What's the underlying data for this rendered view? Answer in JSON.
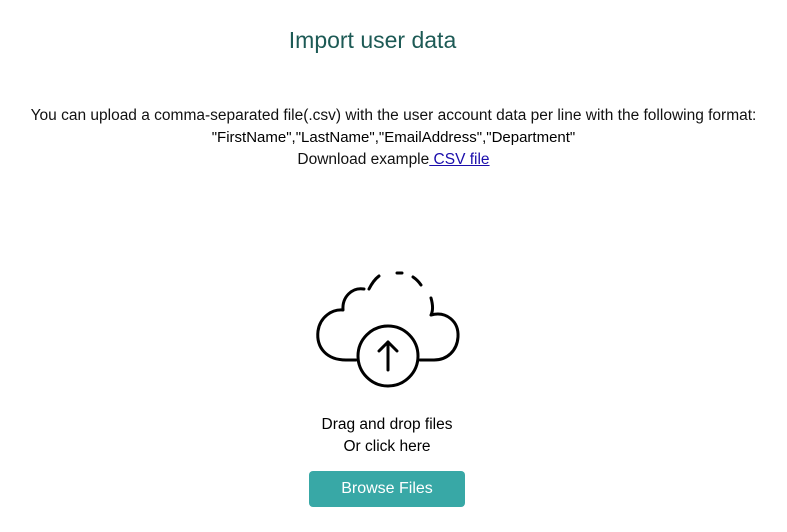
{
  "page": {
    "title": "Import user data"
  },
  "instructions": {
    "line1": "You can upload a comma-separated file(.csv) with the user account data per line with the following format:",
    "format": "\"FirstName\",\"LastName\",\"EmailAddress\",\"Department\"",
    "download_prefix": "Download example",
    "download_link": " CSV file"
  },
  "dropzone": {
    "icon": "cloud-upload-icon",
    "line1": "Drag and drop files",
    "line2": "Or click here"
  },
  "browse_button": {
    "label": "Browse Files"
  },
  "colors": {
    "title": "#1d5a55",
    "button": "#38a8a6",
    "link": "#1a0dab"
  }
}
